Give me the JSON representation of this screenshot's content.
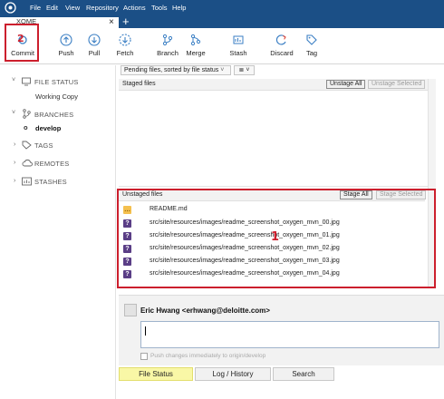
{
  "menu": {
    "items": [
      "File",
      "Edit",
      "View",
      "Repository",
      "Actions",
      "Tools",
      "Help"
    ]
  },
  "tabs": {
    "repo_tab": "XOME",
    "close": "×",
    "new_tab": "+"
  },
  "toolbar": {
    "commit": "Commit",
    "push": "Push",
    "pull": "Pull",
    "fetch": "Fetch",
    "branch": "Branch",
    "merge": "Merge",
    "stash": "Stash",
    "discard": "Discard",
    "tag": "Tag"
  },
  "sidebar": {
    "file_status": "FILE STATUS",
    "working_copy": "Working Copy",
    "branches": "BRANCHES",
    "current_branch": "develop",
    "tags": "TAGS",
    "remotes": "REMOTES",
    "stashes": "STASHES"
  },
  "main": {
    "sort_label": "Pending files, sorted by file status",
    "view_glyph": "≣ ˅",
    "staged": {
      "title": "Staged files",
      "unstage_all": "Unstage All",
      "unstage_selected": "Unstage Selected"
    },
    "unstaged": {
      "title": "Unstaged files",
      "stage_all": "Stage All",
      "stage_selected": "Stage Selected",
      "files": [
        {
          "name": "README.md",
          "status": "modified",
          "glyph": "…"
        },
        {
          "name": "src/site/resources/images/readme_screenshot_oxygen_mvn_00.jpg",
          "status": "untracked",
          "glyph": "?"
        },
        {
          "name": "src/site/resources/images/readme_screenshot_oxygen_mvn_01.jpg",
          "status": "untracked",
          "glyph": "?"
        },
        {
          "name": "src/site/resources/images/readme_screenshot_oxygen_mvn_02.jpg",
          "status": "untracked",
          "glyph": "?"
        },
        {
          "name": "src/site/resources/images/readme_screenshot_oxygen_mvn_03.jpg",
          "status": "untracked",
          "glyph": "?"
        },
        {
          "name": "src/site/resources/images/readme_screenshot_oxygen_mvn_04.jpg",
          "status": "untracked",
          "glyph": "?"
        }
      ]
    }
  },
  "commit": {
    "author": "Eric Hwang <erhwang@deloitte.com>",
    "message": "",
    "push_label": "Push changes immediately to origin/develop"
  },
  "bottom_tabs": [
    "File Status",
    "Log / History",
    "Search"
  ],
  "annotations": {
    "commit_marker": "2",
    "files_marker": "1"
  },
  "colors": {
    "menu_bar": "#1b4f86",
    "annotation_red": "#cc1f2d",
    "active_tab_highlight": "#f9f7a6",
    "untracked_icon": "#5a3e86",
    "modified_icon": "#f4c04e",
    "toolbar_icon": "#3b7fc4"
  }
}
